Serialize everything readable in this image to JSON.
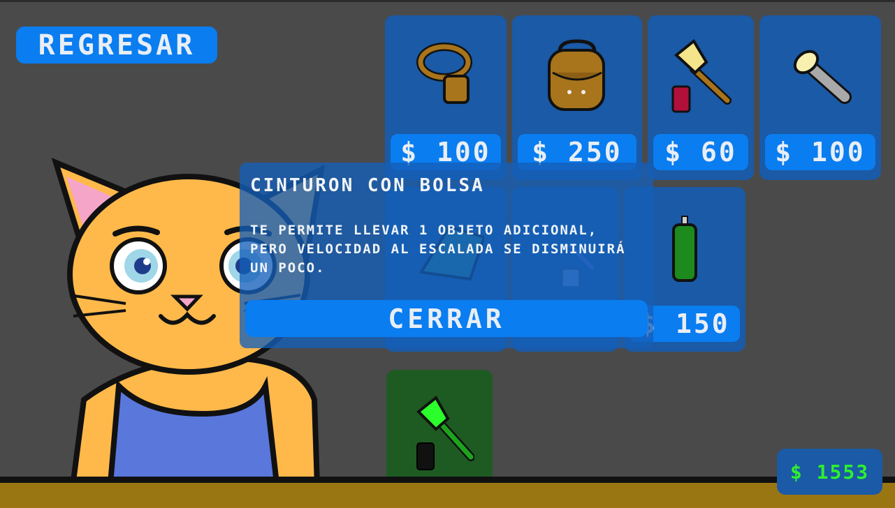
{
  "back_button": {
    "label": "REGRESAR"
  },
  "shop": {
    "row1": [
      {
        "icon": "belt-bag-icon",
        "price": "$ 100"
      },
      {
        "icon": "backpack-icon",
        "price": "$ 250"
      },
      {
        "icon": "paintbrush-red-paint-icon",
        "price": "$ 60"
      },
      {
        "icon": "flashlight-icon",
        "price": "$ 100"
      }
    ],
    "row2": [
      {
        "icon": "crystal-icon"
      },
      {
        "icon": "blue-paint-brush-icon"
      },
      {
        "icon": "green-spray-can-icon",
        "price": "$ 150"
      }
    ],
    "row3": [
      {
        "icon": "green-paintbrush-black-paint-icon"
      }
    ]
  },
  "modal": {
    "title": "CINTURON CON BOLSA",
    "description": "TE PERMITE LLEVAR 1 OBJETO ADICIONAL, PERO VELOCIDAD AL ESCALADA SE DISMINUIRÁ UN POCO.",
    "close_label": "CERRAR"
  },
  "money": {
    "value": "$ 1553"
  },
  "colors": {
    "accent": "#0a7df0",
    "card": "#1a5aa6",
    "money": "#2fef2f",
    "background": "#4a4a4a"
  }
}
